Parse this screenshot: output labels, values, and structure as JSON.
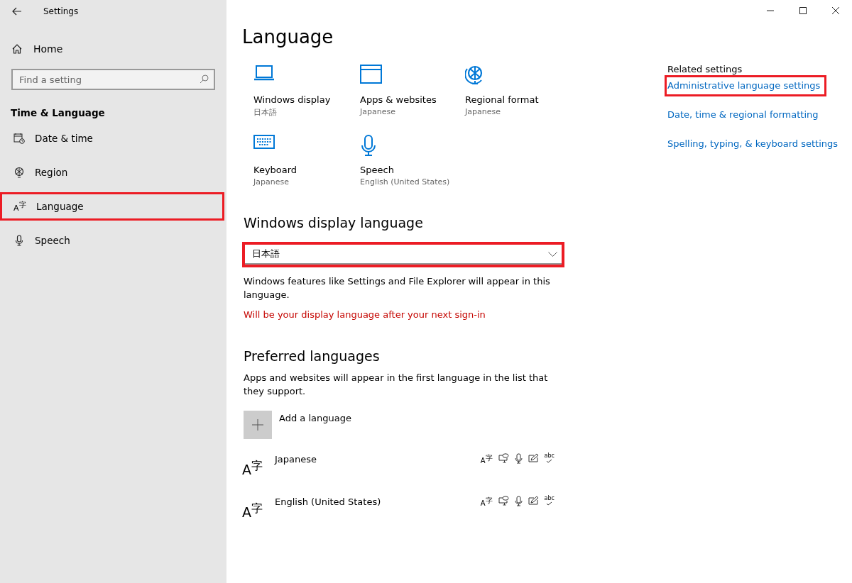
{
  "window": {
    "title": "Settings"
  },
  "sidebar": {
    "home": "Home",
    "search": {
      "placeholder": "Find a setting"
    },
    "section": "Time & Language",
    "items": [
      {
        "label": "Date & time",
        "kind": "calendar",
        "highlighted": false
      },
      {
        "label": "Region",
        "kind": "globe",
        "highlighted": false
      },
      {
        "label": "Language",
        "kind": "language",
        "icon_text": "A$^{字}$",
        "highlighted": true
      },
      {
        "label": "Speech",
        "kind": "microphone",
        "highlighted": false
      }
    ]
  },
  "page": {
    "title": "Language",
    "tiles": [
      {
        "label": "Windows display",
        "value": "日本語",
        "kind": "laptop"
      },
      {
        "label": "Apps & websites",
        "value": "Japanese",
        "kind": "window"
      },
      {
        "label": "Regional format",
        "value": "Japanese",
        "kind": "globe"
      },
      {
        "label": "Keyboard",
        "value": "Japanese",
        "kind": "keyboard"
      },
      {
        "label": "Speech",
        "value": "English (United States)",
        "kind": "microphone"
      }
    ],
    "display_language": {
      "heading": "Windows display language",
      "value": "日本語",
      "highlighted": true,
      "description": "Windows features like Settings and File Explorer will appear in this language.",
      "warning": "Will be your display language after your next sign-in"
    },
    "preferred": {
      "heading": "Preferred languages",
      "description": "Apps and websites will appear in the first language in the list that they support.",
      "add": "Add a language",
      "languages": [
        {
          "name": "Japanese",
          "icon_text": "A$^{字}$",
          "features": [
            {
              "kind": "glyph",
              "text": "A$^{字}$"
            },
            {
              "kind": "display"
            },
            {
              "kind": "microphone"
            },
            {
              "kind": "handwriting"
            },
            {
              "kind": "spelling",
              "text": "abc"
            }
          ]
        },
        {
          "name": "English (United States)",
          "icon_text": "A$^{字}$",
          "features": [
            {
              "kind": "glyph",
              "text": "A$^{字}$"
            },
            {
              "kind": "display"
            },
            {
              "kind": "microphone"
            },
            {
              "kind": "handwriting"
            },
            {
              "kind": "spelling",
              "text": "abc"
            }
          ]
        }
      ]
    }
  },
  "related": {
    "heading": "Related settings",
    "links": [
      {
        "label": "Administrative language settings",
        "highlighted": true
      },
      {
        "label": "Date, time & regional formatting",
        "highlighted": false
      },
      {
        "label": "Spelling, typing, & keyboard settings",
        "highlighted": false
      }
    ]
  }
}
